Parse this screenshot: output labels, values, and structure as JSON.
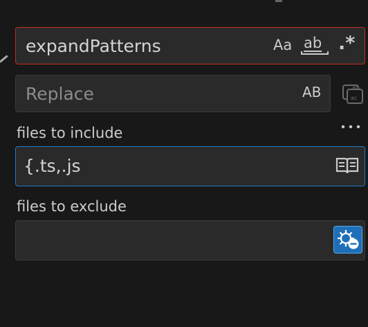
{
  "search": {
    "find_value": "expandPatterns",
    "match_case_label": "Aa",
    "whole_word_label": "ab",
    "regex_label": ".*",
    "replace_placeholder": "Replace",
    "preserve_case_label": "AB"
  },
  "include": {
    "label": "files to include",
    "value": "{.ts,.js"
  },
  "exclude": {
    "label": "files to exclude",
    "value": ""
  },
  "icons": {
    "replace_all": "replace-all-icon",
    "more": "ellipsis-icon",
    "open_editors": "book-icon",
    "exclude_settings": "gear-exclude-icon"
  },
  "colors": {
    "background": "#181818",
    "input_bg": "#2a2a2a",
    "error_border": "#c42b1c",
    "focus_border": "#1f7acb",
    "active_toggle": "#1f6fb8"
  }
}
